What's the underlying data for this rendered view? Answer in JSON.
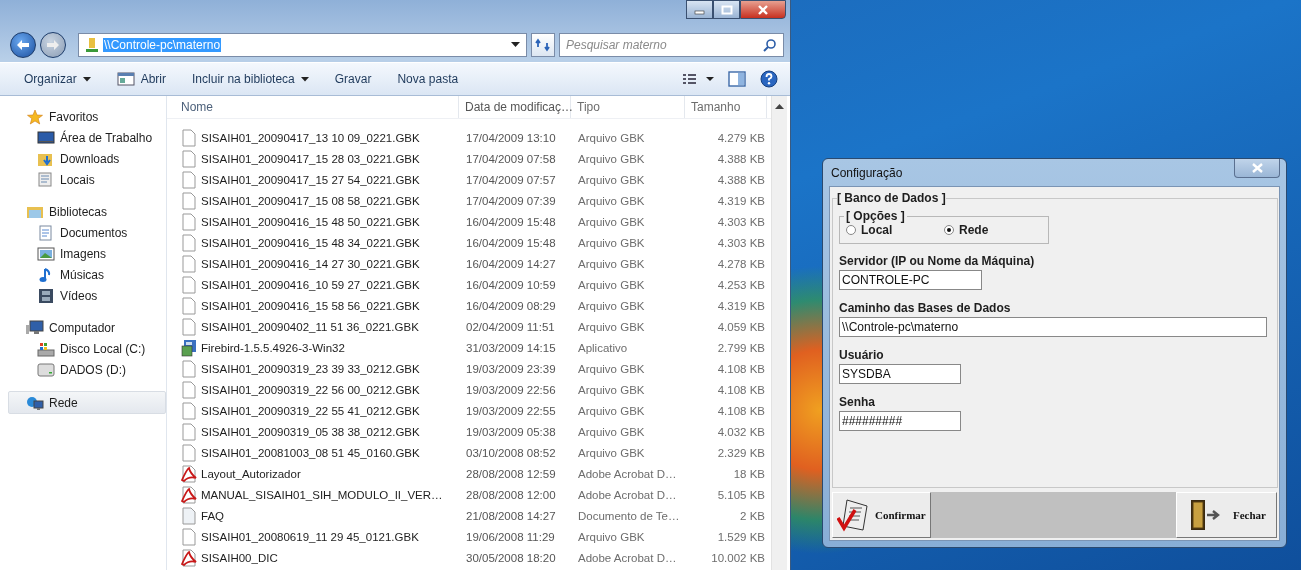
{
  "explorer": {
    "address": {
      "value": "\\\\Controle-pc\\materno",
      "highlighted": true
    },
    "search": {
      "placeholder": "Pesquisar materno"
    },
    "toolbar": [
      {
        "label": "Organizar",
        "kind": "menu"
      },
      {
        "label": "Abrir",
        "kind": "open"
      },
      {
        "label": "Incluir na biblioteca",
        "kind": "menu"
      },
      {
        "label": "Gravar",
        "kind": "plain"
      },
      {
        "label": "Nova pasta",
        "kind": "plain"
      }
    ],
    "nav": [
      {
        "label": "Favoritos",
        "kind": "star",
        "selected": false,
        "children": [
          {
            "label": "Área de Trabalho",
            "kind": "desktop",
            "selected": false
          },
          {
            "label": "Downloads",
            "kind": "downloads",
            "selected": false
          },
          {
            "label": "Locais",
            "kind": "recent",
            "selected": false
          }
        ]
      },
      {
        "label": "Bibliotecas",
        "kind": "library",
        "selected": false,
        "children": [
          {
            "label": "Documentos",
            "kind": "documents",
            "selected": false
          },
          {
            "label": "Imagens",
            "kind": "pictures",
            "selected": false
          },
          {
            "label": "Músicas",
            "kind": "music",
            "selected": false
          },
          {
            "label": "Vídeos",
            "kind": "videos",
            "selected": false
          }
        ]
      },
      {
        "label": "Computador",
        "kind": "computer",
        "selected": false,
        "children": [
          {
            "label": "Disco Local (C:)",
            "kind": "system-disk",
            "selected": false
          },
          {
            "label": "DADOS (D:)",
            "kind": "drive",
            "selected": false
          }
        ]
      },
      {
        "label": "Rede",
        "kind": "network",
        "selected": true
      }
    ],
    "columns": [
      "Nome",
      "Data de modificaç…",
      "Tipo",
      "Tamanho"
    ],
    "rows": [
      {
        "name": "SISAIH01_20090417_13 10 09_0221.GBK",
        "date": "17/04/2009 13:10",
        "type": "Arquivo GBK",
        "size": "4.279 KB",
        "kind": "blank"
      },
      {
        "name": "SISAIH01_20090417_15 28 03_0221.GBK",
        "date": "17/04/2009 07:58",
        "type": "Arquivo GBK",
        "size": "4.388 KB",
        "kind": "blank"
      },
      {
        "name": "SISAIH01_20090417_15 27 54_0221.GBK",
        "date": "17/04/2009 07:57",
        "type": "Arquivo GBK",
        "size": "4.388 KB",
        "kind": "blank"
      },
      {
        "name": "SISAIH01_20090417_15 08 58_0221.GBK",
        "date": "17/04/2009 07:39",
        "type": "Arquivo GBK",
        "size": "4.319 KB",
        "kind": "blank"
      },
      {
        "name": "SISAIH01_20090416_15 48 50_0221.GBK",
        "date": "16/04/2009 15:48",
        "type": "Arquivo GBK",
        "size": "4.303 KB",
        "kind": "blank"
      },
      {
        "name": "SISAIH01_20090416_15 48 34_0221.GBK",
        "date": "16/04/2009 15:48",
        "type": "Arquivo GBK",
        "size": "4.303 KB",
        "kind": "blank"
      },
      {
        "name": "SISAIH01_20090416_14 27 30_0221.GBK",
        "date": "16/04/2009 14:27",
        "type": "Arquivo GBK",
        "size": "4.278 KB",
        "kind": "blank"
      },
      {
        "name": "SISAIH01_20090416_10 59 27_0221.GBK",
        "date": "16/04/2009 10:59",
        "type": "Arquivo GBK",
        "size": "4.253 KB",
        "kind": "blank"
      },
      {
        "name": "SISAIH01_20090416_15 58 56_0221.GBK",
        "date": "16/04/2009 08:29",
        "type": "Arquivo GBK",
        "size": "4.319 KB",
        "kind": "blank"
      },
      {
        "name": "SISAIH01_20090402_11 51 36_0221.GBK",
        "date": "02/04/2009 11:51",
        "type": "Arquivo GBK",
        "size": "4.059 KB",
        "kind": "blank"
      },
      {
        "name": "Firebird-1.5.5.4926-3-Win32",
        "date": "31/03/2009 14:15",
        "type": "Aplicativo",
        "size": "2.799 KB",
        "kind": "app"
      },
      {
        "name": "SISAIH01_20090319_23 39 33_0212.GBK",
        "date": "19/03/2009 23:39",
        "type": "Arquivo GBK",
        "size": "4.108 KB",
        "kind": "blank"
      },
      {
        "name": "SISAIH01_20090319_22 56 00_0212.GBK",
        "date": "19/03/2009 22:56",
        "type": "Arquivo GBK",
        "size": "4.108 KB",
        "kind": "blank"
      },
      {
        "name": "SISAIH01_20090319_22 55 41_0212.GBK",
        "date": "19/03/2009 22:55",
        "type": "Arquivo GBK",
        "size": "4.108 KB",
        "kind": "blank"
      },
      {
        "name": "SISAIH01_20090319_05 38 38_0212.GBK",
        "date": "19/03/2009 05:38",
        "type": "Arquivo GBK",
        "size": "4.032 KB",
        "kind": "blank"
      },
      {
        "name": "SISAIH01_20081003_08 51 45_0160.GBK",
        "date": "03/10/2008 08:52",
        "type": "Arquivo GBK",
        "size": "2.329 KB",
        "kind": "blank"
      },
      {
        "name": "Layout_Autorizador",
        "date": "28/08/2008 12:59",
        "type": "Adobe Acrobat D…",
        "size": "18 KB",
        "kind": "pdf"
      },
      {
        "name": "MANUAL_SISAIH01_SIH_MODULO_II_VER…",
        "date": "28/08/2008 12:00",
        "type": "Adobe Acrobat D…",
        "size": "5.105 KB",
        "kind": "pdf"
      },
      {
        "name": "FAQ",
        "date": "21/08/2008 14:27",
        "type": "Documento de Te…",
        "size": "2 KB",
        "kind": "text"
      },
      {
        "name": "SISAIH01_20080619_11 29 45_0121.GBK",
        "date": "19/06/2008 11:29",
        "type": "Arquivo GBK",
        "size": "1.529 KB",
        "kind": "blank"
      },
      {
        "name": "SISAIH00_DIC",
        "date": "30/05/2008 18:20",
        "type": "Adobe Acrobat D…",
        "size": "10.002 KB",
        "kind": "pdf"
      }
    ]
  },
  "dialog": {
    "title": "Configuração",
    "group": "[ Banco de Dados ]",
    "options_group": "[ Opções ]",
    "options": [
      {
        "label": "Local",
        "selected": false
      },
      {
        "label": "Rede",
        "selected": true
      }
    ],
    "fields": [
      {
        "label": "Servidor (IP ou Nome da Máquina)",
        "value": "CONTROLE-PC",
        "kind": "short"
      },
      {
        "label": "Caminho das Bases de Dados",
        "value": "\\\\Controle-pc\\materno",
        "kind": "long"
      },
      {
        "label": "Usuário",
        "value": "SYSDBA",
        "kind": "small"
      },
      {
        "label": "Senha",
        "value": "#########",
        "kind": "small"
      }
    ],
    "buttons": [
      {
        "label": "Confirmar",
        "kind": "confirm"
      },
      {
        "label": "Fechar",
        "kind": "close"
      }
    ]
  }
}
